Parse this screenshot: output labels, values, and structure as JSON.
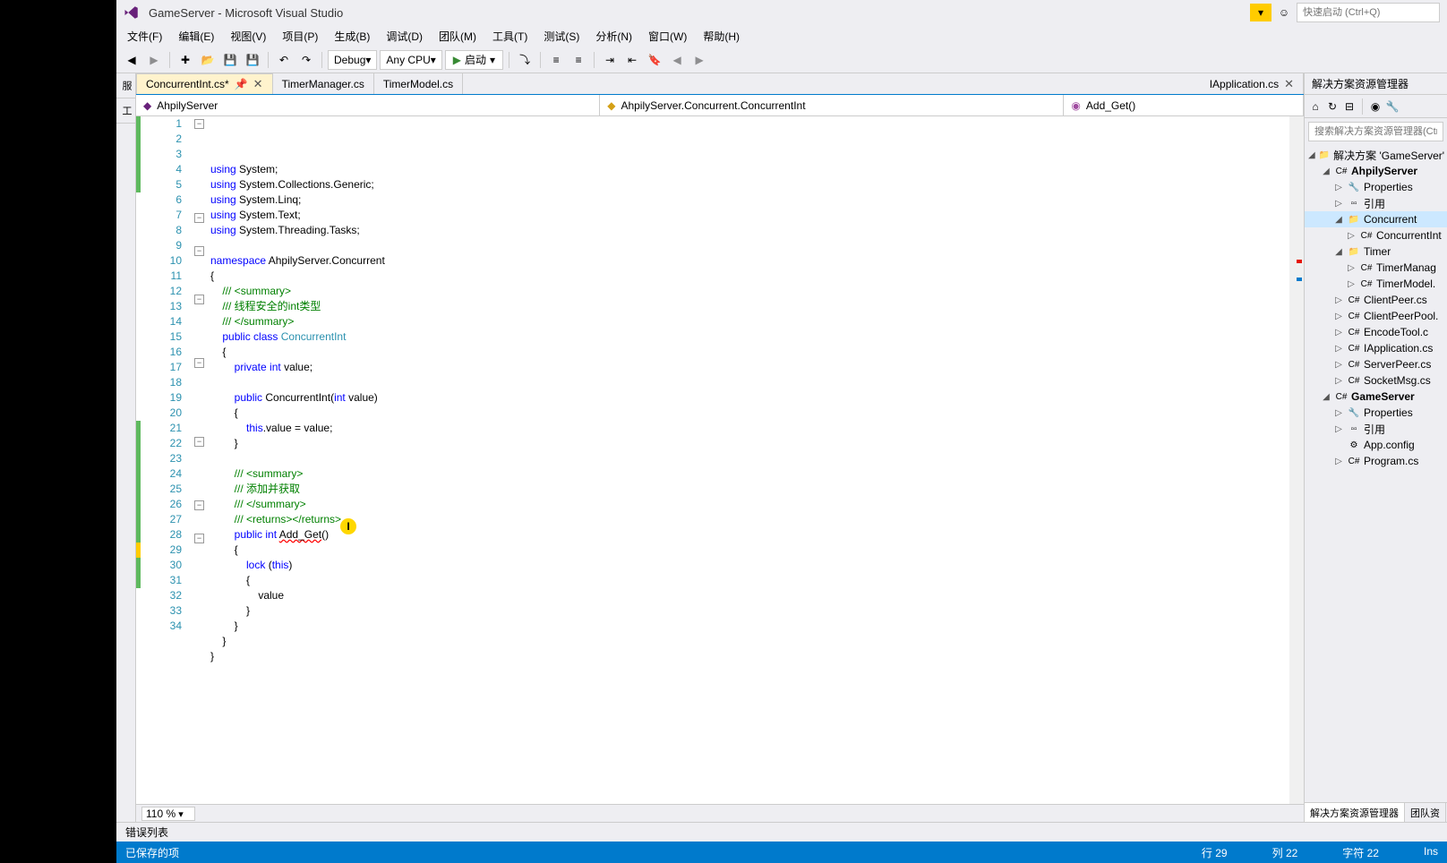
{
  "title": "GameServer - Microsoft Visual Studio",
  "quickLaunch": "快速启动 (Ctrl+Q)",
  "menus": [
    "文件(F)",
    "编辑(E)",
    "视图(V)",
    "项目(P)",
    "生成(B)",
    "调试(D)",
    "团队(M)",
    "工具(T)",
    "测试(S)",
    "分析(N)",
    "窗口(W)",
    "帮助(H)"
  ],
  "toolbar": {
    "config": "Debug",
    "platform": "Any CPU",
    "start": "启动"
  },
  "tabs": {
    "active": "ConcurrentInt.cs*",
    "others": [
      "TimerManager.cs",
      "TimerModel.cs"
    ],
    "rightTab": "IApplication.cs"
  },
  "navBar": {
    "project": "AhpilyServer",
    "class": "AhpilyServer.Concurrent.ConcurrentInt",
    "member": "Add_Get()"
  },
  "code": {
    "lines": [
      {
        "n": 1,
        "html": "<span class='kw'>using</span> System;"
      },
      {
        "n": 2,
        "html": "<span class='kw'>using</span> System.Collections.Generic;"
      },
      {
        "n": 3,
        "html": "<span class='kw'>using</span> System.Linq;"
      },
      {
        "n": 4,
        "html": "<span class='kw'>using</span> System.Text;"
      },
      {
        "n": 5,
        "html": "<span class='kw'>using</span> System.Threading.Tasks;"
      },
      {
        "n": 6,
        "html": ""
      },
      {
        "n": 7,
        "html": "<span class='kw'>namespace</span> AhpilyServer.Concurrent"
      },
      {
        "n": 8,
        "html": "{"
      },
      {
        "n": 9,
        "html": "    <span class='cmt'>/// &lt;summary&gt;</span>"
      },
      {
        "n": 10,
        "html": "    <span class='cmt'>/// 线程安全的int类型</span>"
      },
      {
        "n": 11,
        "html": "    <span class='cmt'>/// &lt;/summary&gt;</span>"
      },
      {
        "n": 12,
        "html": "    <span class='kw'>public</span> <span class='kw'>class</span> <span class='type'>ConcurrentInt</span>"
      },
      {
        "n": 13,
        "html": "    {"
      },
      {
        "n": 14,
        "html": "        <span class='kw'>private</span> <span class='kw'>int</span> value;"
      },
      {
        "n": 15,
        "html": ""
      },
      {
        "n": 16,
        "html": "        <span class='kw'>public</span> ConcurrentInt(<span class='kw'>int</span> value)"
      },
      {
        "n": 17,
        "html": "        {"
      },
      {
        "n": 18,
        "html": "            <span class='kw'>this</span>.value = value;"
      },
      {
        "n": 19,
        "html": "        }"
      },
      {
        "n": 20,
        "html": ""
      },
      {
        "n": 21,
        "html": "        <span class='cmt'>/// &lt;summary&gt;</span>"
      },
      {
        "n": 22,
        "html": "        <span class='cmt'>/// 添加并获取</span>"
      },
      {
        "n": 23,
        "html": "        <span class='cmt'>/// &lt;/summary&gt;</span>"
      },
      {
        "n": 24,
        "html": "        <span class='cmt'>/// &lt;returns&gt;&lt;/returns&gt;</span>"
      },
      {
        "n": 25,
        "html": "        <span class='kw'>public</span> <span class='kw'>int</span> <span class='err-underline'>Add_Get</span>()"
      },
      {
        "n": 26,
        "html": "        {"
      },
      {
        "n": 27,
        "html": "            <span class='kw'>lock</span> (<span class='kw'>this</span>)"
      },
      {
        "n": 28,
        "html": "            {"
      },
      {
        "n": 29,
        "html": "                value"
      },
      {
        "n": 30,
        "html": "            }"
      },
      {
        "n": 31,
        "html": "        }"
      },
      {
        "n": 32,
        "html": "    }"
      },
      {
        "n": 33,
        "html": "}"
      },
      {
        "n": 34,
        "html": ""
      }
    ]
  },
  "zoom": "110 %",
  "solutionExplorer": {
    "title": "解决方案资源管理器",
    "search": "搜索解决方案资源管理器(Ctrl",
    "root": "解决方案 'GameServer'",
    "nodes": [
      {
        "indent": 0,
        "exp": "◢",
        "icon": "sln",
        "label": "解决方案 'GameServer'"
      },
      {
        "indent": 1,
        "exp": "◢",
        "icon": "csproj",
        "label": "AhpilyServer",
        "bold": true
      },
      {
        "indent": 2,
        "exp": "▷",
        "icon": "wrench",
        "label": "Properties"
      },
      {
        "indent": 2,
        "exp": "▷",
        "icon": "ref",
        "label": "引用"
      },
      {
        "indent": 2,
        "exp": "◢",
        "icon": "folder",
        "label": "Concurrent",
        "sel": true
      },
      {
        "indent": 3,
        "exp": "▷",
        "icon": "cs",
        "label": "ConcurrentInt"
      },
      {
        "indent": 2,
        "exp": "◢",
        "icon": "folder",
        "label": "Timer"
      },
      {
        "indent": 3,
        "exp": "▷",
        "icon": "cs",
        "label": "TimerManag"
      },
      {
        "indent": 3,
        "exp": "▷",
        "icon": "cs",
        "label": "TimerModel."
      },
      {
        "indent": 2,
        "exp": "▷",
        "icon": "cs",
        "label": "ClientPeer.cs"
      },
      {
        "indent": 2,
        "exp": "▷",
        "icon": "cs",
        "label": "ClientPeerPool."
      },
      {
        "indent": 2,
        "exp": "▷",
        "icon": "cs",
        "label": "EncodeTool.c"
      },
      {
        "indent": 2,
        "exp": "▷",
        "icon": "cs",
        "label": "IApplication.cs"
      },
      {
        "indent": 2,
        "exp": "▷",
        "icon": "cs",
        "label": "ServerPeer.cs"
      },
      {
        "indent": 2,
        "exp": "▷",
        "icon": "cs",
        "label": "SocketMsg.cs"
      },
      {
        "indent": 1,
        "exp": "◢",
        "icon": "csproj",
        "label": "GameServer",
        "bold": true
      },
      {
        "indent": 2,
        "exp": "▷",
        "icon": "wrench",
        "label": "Properties"
      },
      {
        "indent": 2,
        "exp": "▷",
        "icon": "ref",
        "label": "引用"
      },
      {
        "indent": 2,
        "exp": "",
        "icon": "cfg",
        "label": "App.config"
      },
      {
        "indent": 2,
        "exp": "▷",
        "icon": "cs",
        "label": "Program.cs"
      }
    ],
    "bottomTabs": [
      "解决方案资源管理器",
      "团队资"
    ]
  },
  "bottomPanel": "错误列表",
  "statusBar": {
    "left": "已保存的项",
    "line": "行 29",
    "col": "列 22",
    "char": "字符 22",
    "ins": "Ins"
  }
}
